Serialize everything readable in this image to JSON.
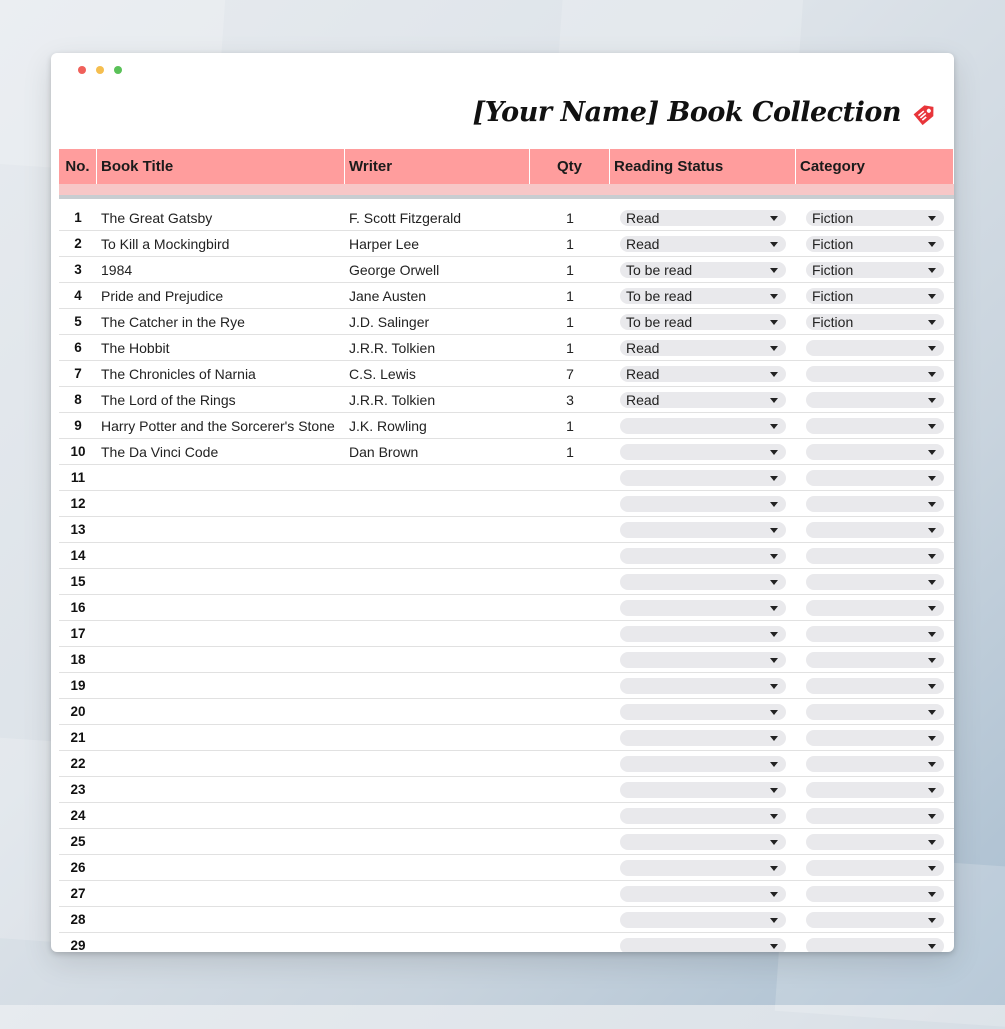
{
  "window": {
    "dots": [
      "#f0605a",
      "#f5be4f",
      "#5ac158"
    ]
  },
  "sheet": {
    "title": "[Your Name] Book Collection",
    "title_icon": "bookmark-tag-icon",
    "headers": {
      "no": "No.",
      "title": "Book Title",
      "writer": "Writer",
      "qty": "Qty",
      "status": "Reading Status",
      "category": "Category"
    },
    "rows": [
      {
        "no": "1",
        "title": "The Great Gatsby",
        "writer": "F. Scott Fitzgerald",
        "qty": "1",
        "status": "Read",
        "category": "Fiction"
      },
      {
        "no": "2",
        "title": "To Kill a Mockingbird",
        "writer": "Harper Lee",
        "qty": "1",
        "status": "Read",
        "category": "Fiction"
      },
      {
        "no": "3",
        "title": "1984",
        "writer": "George Orwell",
        "qty": "1",
        "status": "To be read",
        "category": "Fiction"
      },
      {
        "no": "4",
        "title": "Pride and Prejudice",
        "writer": "Jane Austen",
        "qty": "1",
        "status": "To be read",
        "category": "Fiction"
      },
      {
        "no": "5",
        "title": "The Catcher in the Rye",
        "writer": "J.D. Salinger",
        "qty": "1",
        "status": "To be read",
        "category": "Fiction"
      },
      {
        "no": "6",
        "title": "The Hobbit",
        "writer": "J.R.R. Tolkien",
        "qty": "1",
        "status": "Read",
        "category": ""
      },
      {
        "no": "7",
        "title": "The Chronicles of Narnia",
        "writer": "C.S. Lewis",
        "qty": "7",
        "status": "Read",
        "category": ""
      },
      {
        "no": "8",
        "title": "The Lord of the Rings",
        "writer": "J.R.R. Tolkien",
        "qty": "3",
        "status": "Read",
        "category": ""
      },
      {
        "no": "9",
        "title": "Harry Potter and the Sorcerer's Stone",
        "writer": "J.K. Rowling",
        "qty": "1",
        "status": "",
        "category": ""
      },
      {
        "no": "10",
        "title": "The Da Vinci Code",
        "writer": "Dan Brown",
        "qty": "1",
        "status": "",
        "category": ""
      },
      {
        "no": "11",
        "title": "",
        "writer": "",
        "qty": "",
        "status": "",
        "category": ""
      },
      {
        "no": "12",
        "title": "",
        "writer": "",
        "qty": "",
        "status": "",
        "category": ""
      },
      {
        "no": "13",
        "title": "",
        "writer": "",
        "qty": "",
        "status": "",
        "category": ""
      },
      {
        "no": "14",
        "title": "",
        "writer": "",
        "qty": "",
        "status": "",
        "category": ""
      },
      {
        "no": "15",
        "title": "",
        "writer": "",
        "qty": "",
        "status": "",
        "category": ""
      },
      {
        "no": "16",
        "title": "",
        "writer": "",
        "qty": "",
        "status": "",
        "category": ""
      },
      {
        "no": "17",
        "title": "",
        "writer": "",
        "qty": "",
        "status": "",
        "category": ""
      },
      {
        "no": "18",
        "title": "",
        "writer": "",
        "qty": "",
        "status": "",
        "category": ""
      },
      {
        "no": "19",
        "title": "",
        "writer": "",
        "qty": "",
        "status": "",
        "category": ""
      },
      {
        "no": "20",
        "title": "",
        "writer": "",
        "qty": "",
        "status": "",
        "category": ""
      },
      {
        "no": "21",
        "title": "",
        "writer": "",
        "qty": "",
        "status": "",
        "category": ""
      },
      {
        "no": "22",
        "title": "",
        "writer": "",
        "qty": "",
        "status": "",
        "category": ""
      },
      {
        "no": "23",
        "title": "",
        "writer": "",
        "qty": "",
        "status": "",
        "category": ""
      },
      {
        "no": "24",
        "title": "",
        "writer": "",
        "qty": "",
        "status": "",
        "category": ""
      },
      {
        "no": "25",
        "title": "",
        "writer": "",
        "qty": "",
        "status": "",
        "category": ""
      },
      {
        "no": "26",
        "title": "",
        "writer": "",
        "qty": "",
        "status": "",
        "category": ""
      },
      {
        "no": "27",
        "title": "",
        "writer": "",
        "qty": "",
        "status": "",
        "category": ""
      },
      {
        "no": "28",
        "title": "",
        "writer": "",
        "qty": "",
        "status": "",
        "category": ""
      },
      {
        "no": "29",
        "title": "",
        "writer": "",
        "qty": "",
        "status": "",
        "category": ""
      }
    ]
  },
  "colors": {
    "header_bg": "#ff9d9d",
    "subheader_bg": "#f7c7c7",
    "dropdown_bg": "#e9e9ec",
    "tag_icon": "#e8353a"
  }
}
